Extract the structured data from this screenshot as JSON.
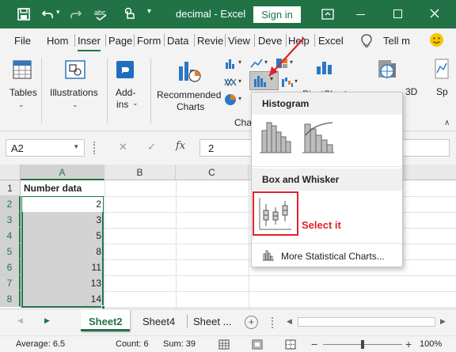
{
  "titlebar": {
    "doc_title": "decimal  -  Excel",
    "signin_label": "Sign in",
    "accent": "#217346",
    "icons": [
      "save-icon",
      "undo-icon",
      "redo-icon",
      "spellcheck-icon",
      "touch-icon",
      "customize-icon",
      "ribbon-display-icon",
      "minimize-icon",
      "maximize-icon",
      "close-icon"
    ]
  },
  "tabs": [
    "File",
    "Hom",
    "Inser",
    "Page",
    "Form",
    "Data",
    "Revie",
    "View",
    "Deve",
    "Help",
    "Excel"
  ],
  "active_tab": "Inser",
  "tell_me": "Tell m",
  "ribbon": {
    "tables_label": "Tables",
    "illustrations_label": "Illustrations",
    "addins_label1": "Add-",
    "addins_label2": "ins",
    "recommended_label1": "Recommended",
    "recommended_label2": "Charts",
    "charts_group_label": "Cha",
    "pivotchart_label": "PivotChart",
    "threed_label": "3D",
    "sp_label": "Sp"
  },
  "formula_bar": {
    "name_box": "A2",
    "cancel_glyph": "✕",
    "enter_glyph": "✓",
    "fx": "fx",
    "value": "2"
  },
  "grid": {
    "columns": [
      "A",
      "B",
      "C"
    ],
    "rows": [
      "1",
      "2",
      "3",
      "4",
      "5",
      "6",
      "7",
      "8"
    ],
    "header_cell": "Number data",
    "values": [
      "2",
      "3",
      "5",
      "8",
      "11",
      "13",
      "14"
    ]
  },
  "dropdown": {
    "histogram_heading": "Histogram",
    "box_whisker_heading": "Box and Whisker",
    "annotation": "Select it",
    "more_label": "More Statistical Charts...",
    "annotation_color": "#e0222a"
  },
  "sheets": {
    "active": "Sheet2",
    "tab2": "Sheet4",
    "tab3": "Sheet ...",
    "add_glyph": "+"
  },
  "status": {
    "average": "Average: 6.5",
    "count": "Count: 6",
    "sum": "Sum: 39",
    "zoom": "100%",
    "minus": "−",
    "plus": "+"
  }
}
